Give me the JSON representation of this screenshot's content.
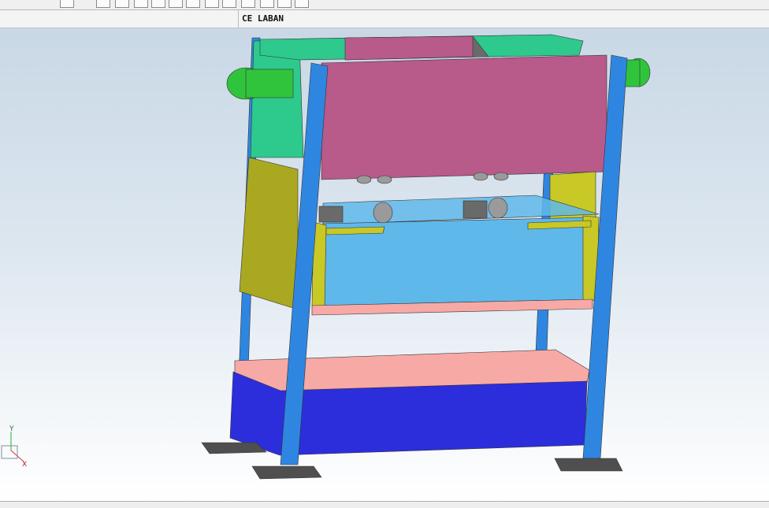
{
  "toolbar": {
    "buttons": [
      {
        "name": "select-filter-button",
        "icon": "dashed-box-icon"
      },
      {
        "name": "snap-points-button",
        "icon": "snap-points-icon"
      },
      {
        "name": "snap-gear-button",
        "icon": "gear-icon"
      },
      {
        "name": "line-tool-button",
        "icon": "line-icon"
      },
      {
        "name": "arrow-tool-button",
        "icon": "arrow-icon"
      },
      {
        "name": "arc-tool-button",
        "icon": "arc-icon"
      },
      {
        "name": "axis-tool-button",
        "icon": "axis-icon"
      },
      {
        "name": "rotate-tool-button",
        "icon": "rotate-icon"
      },
      {
        "name": "circle-point-button",
        "icon": "circle-point-icon"
      },
      {
        "name": "crosshair-button",
        "icon": "crosshair-icon"
      },
      {
        "name": "pen-tool-button",
        "icon": "pen-icon"
      },
      {
        "name": "view-direction-button",
        "icon": "view-icon"
      },
      {
        "name": "render-style-button",
        "icon": "cube-icon"
      }
    ]
  },
  "window": {
    "title": "CE LABAN"
  },
  "viewport": {
    "triad": {
      "y_label": "Y",
      "x_label": "X"
    },
    "colors": {
      "column": "#2f86e0",
      "frame_green": "#2ec98c",
      "motor_green": "#2fc43c",
      "top_cover": "#b85a8a",
      "mid_box": "#5fb8ea",
      "yellow_panel": "#c8c826",
      "olive_panel": "#a9a820",
      "pink_plate": "#f7a9a6",
      "bed_base": "#2c2edc",
      "foot_plate": "#4f4f4f"
    }
  }
}
